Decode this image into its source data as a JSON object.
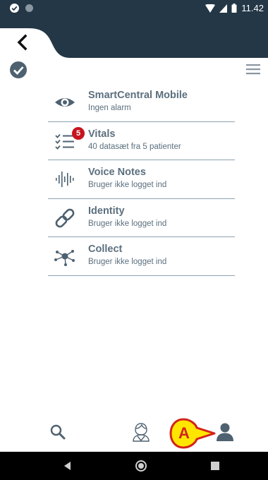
{
  "status_bar": {
    "time": "11.42"
  },
  "header": {
    "back_icon": "chevron-left-icon",
    "check_icon": "check-circle-icon",
    "menu_icon": "hamburger-menu-icon"
  },
  "modules": [
    {
      "title": "SmartCentral Mobile",
      "subtitle": "Ingen alarm",
      "icon": "eye-icon",
      "badge": ""
    },
    {
      "title": "Vitals",
      "subtitle": "40 datasæt fra 5 patienter",
      "icon": "checklist-icon",
      "badge": "5"
    },
    {
      "title": "Voice Notes",
      "subtitle": "Bruger ikke logget ind",
      "icon": "audio-wave-icon",
      "badge": ""
    },
    {
      "title": "Identity",
      "subtitle": "Bruger ikke logget ind",
      "icon": "link-icon",
      "badge": ""
    },
    {
      "title": "Collect",
      "subtitle": "Bruger ikke logget ind",
      "icon": "network-nodes-icon",
      "badge": ""
    }
  ],
  "toolbar": {
    "search_icon": "search-icon",
    "patient_icon": "patient-icon",
    "user_icon": "user-icon"
  },
  "callout": {
    "letter": "A"
  },
  "colors": {
    "header": "#233746",
    "text": "#5b6f7e",
    "divider": "#8ea2b1",
    "badge": "#c7141f",
    "callout_fill": "#ffe600",
    "callout_stroke": "#d3231a"
  }
}
